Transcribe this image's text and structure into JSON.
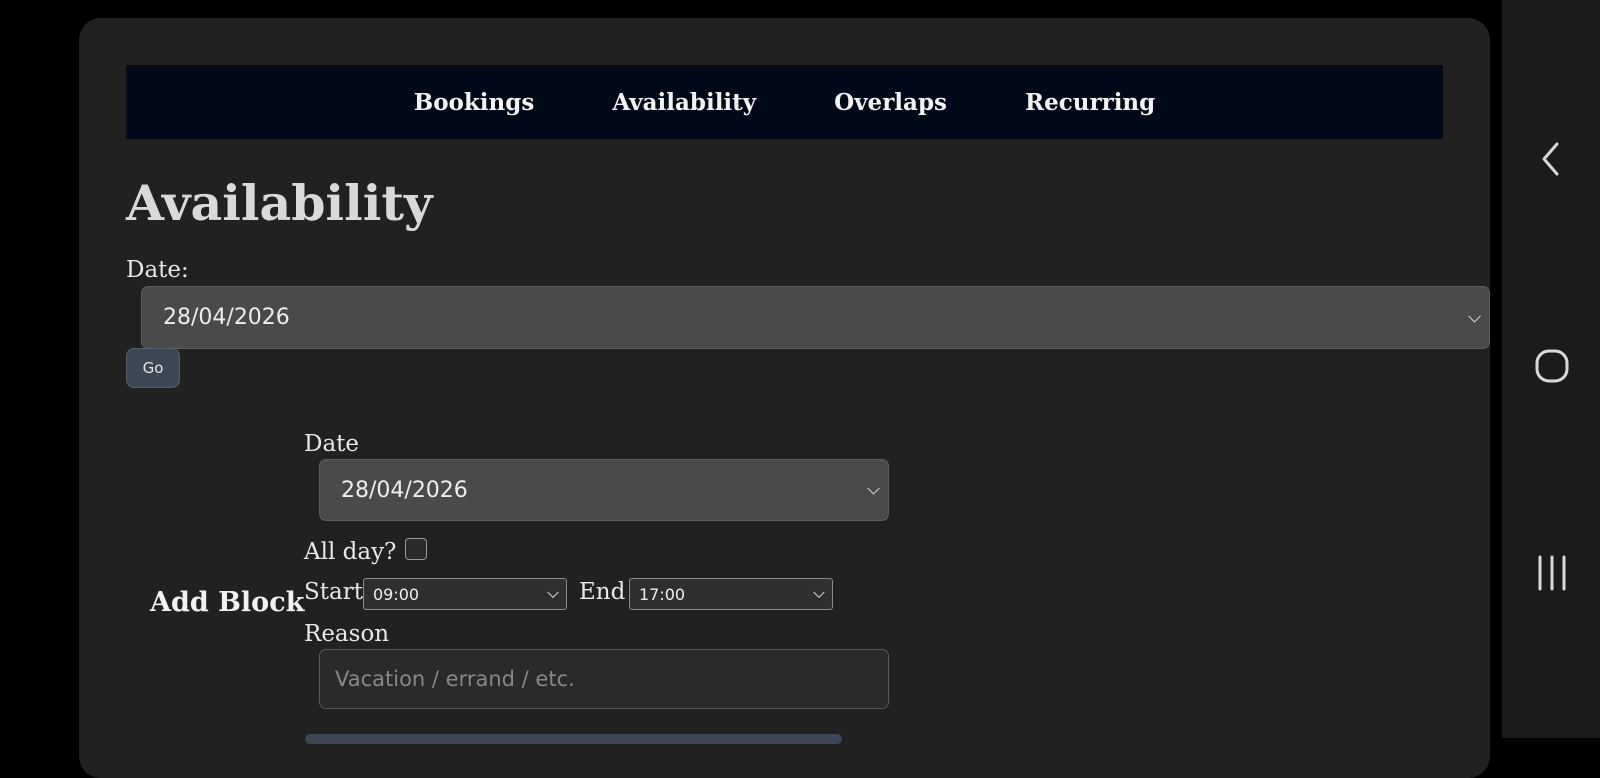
{
  "nav": {
    "items": [
      "Bookings",
      "Availability",
      "Overlaps",
      "Recurring"
    ]
  },
  "page": {
    "title": "Availability",
    "date_label": "Date:",
    "date_value": "28/04/2026",
    "go_label": "Go"
  },
  "add_block": {
    "heading": "Add Block",
    "date_label": "Date",
    "date_value": "28/04/2026",
    "all_day_label": "All day?",
    "all_day_checked": false,
    "start_label": "Start",
    "start_value": "09:00",
    "end_label": "End",
    "end_value": "17:00",
    "reason_label": "Reason",
    "reason_placeholder": "Vacation / errand / etc.",
    "reason_value": ""
  },
  "system_nav": {
    "icons": [
      "back-icon",
      "home-icon",
      "recent-apps-icon"
    ]
  },
  "colors": {
    "background": "#000000",
    "card": "#212121",
    "nav_bar": "#020919",
    "select_bg": "#4a4a4a",
    "button_bg": "#3d4654"
  }
}
